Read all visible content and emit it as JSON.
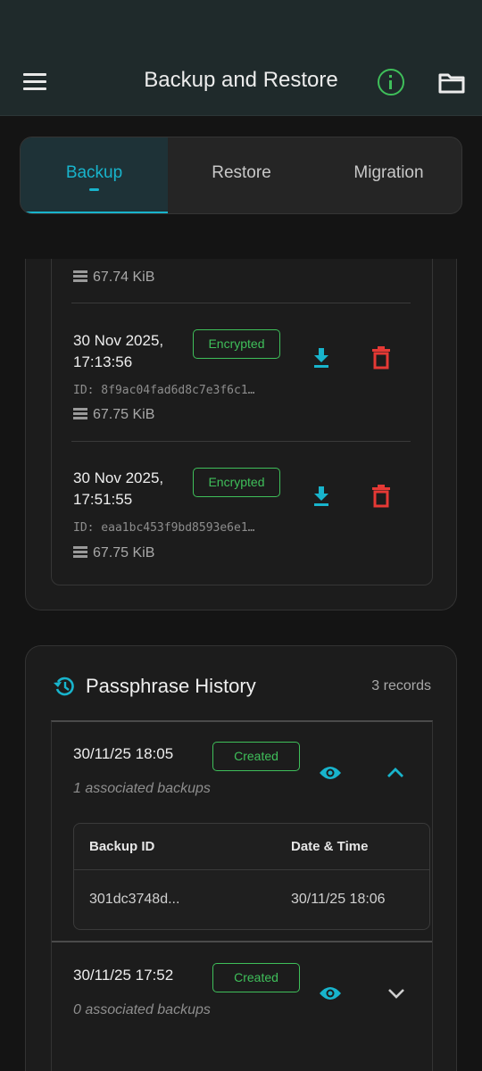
{
  "appbar": {
    "title": "Backup and Restore",
    "icons": {
      "menu": "menu-icon",
      "info": "info-icon",
      "folder": "folder-icon"
    },
    "accent_info": "#3fbf5a"
  },
  "tabs": [
    {
      "label": "Backup",
      "active": true
    },
    {
      "label": "Restore",
      "active": false
    },
    {
      "label": "Migration",
      "active": false
    }
  ],
  "accent_color": "#18b4cc",
  "delete_color": "#e53935",
  "backups": {
    "partial_size": "67.74 KiB",
    "entries": [
      {
        "date_line1": "30 Nov 2025,",
        "date_line2": "17:13:56",
        "badge": "Encrypted",
        "id": "ID: 8f9ac04fad6d8c7e3f6c1…",
        "size": "67.75 KiB"
      },
      {
        "date_line1": "30 Nov 2025,",
        "date_line2": "17:51:55",
        "badge": "Encrypted",
        "id": "ID: eaa1bc453f9bd8593e6e1…",
        "size": "67.75 KiB"
      }
    ]
  },
  "passphrase_history": {
    "title": "Passphrase History",
    "count": "3 records",
    "records": [
      {
        "date": "30/11/25 18:05",
        "badge": "Created",
        "associated": "1 associated backups",
        "expanded": true,
        "table": {
          "headers": [
            "Backup ID",
            "Date & Time"
          ],
          "rows": [
            [
              "301dc3748d...",
              "30/11/25 18:06"
            ]
          ]
        }
      },
      {
        "date": "30/11/25 17:52",
        "badge": "Created",
        "associated": "0 associated backups",
        "expanded": false
      }
    ]
  }
}
